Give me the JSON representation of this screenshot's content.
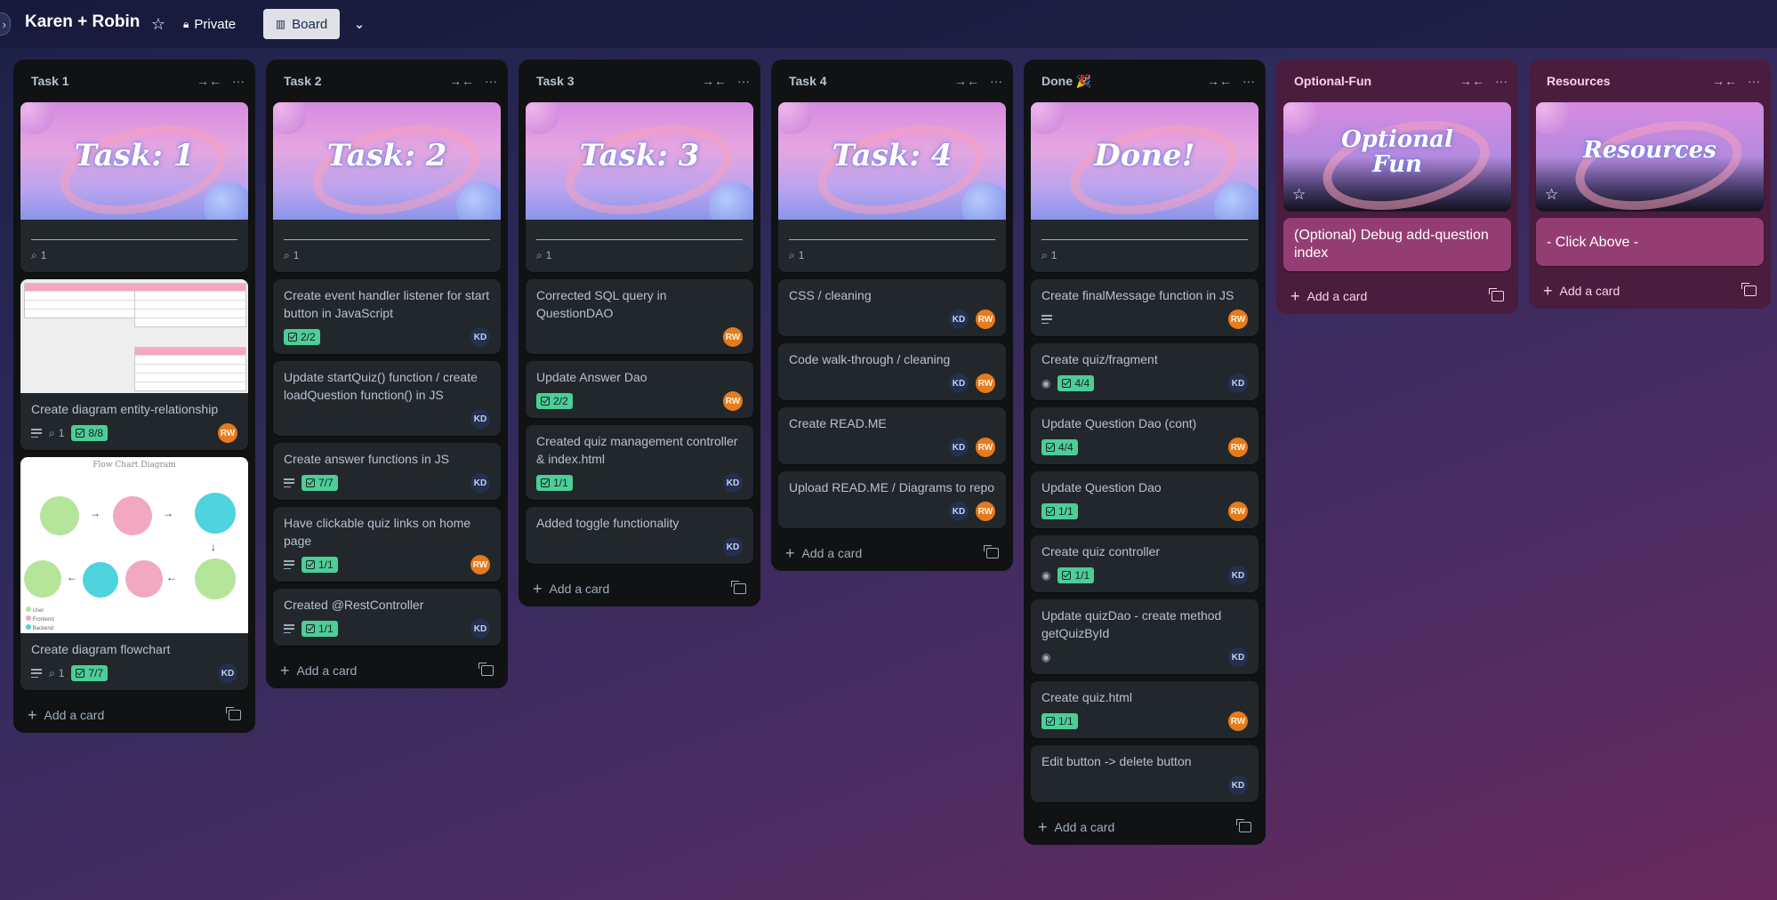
{
  "header": {
    "board_title": "Karen + Robin",
    "visibility": "Private",
    "view": "Board"
  },
  "colors": {
    "checklist_green": "#4bce97",
    "rw_avatar": "#e57a1f",
    "kd_avatar": "#23304f",
    "pink_list": "#4a1d3e"
  },
  "icons": [
    "star-icon",
    "lock-icon",
    "board-icon",
    "chevron-down-icon",
    "collapse-icon",
    "more-icon",
    "description-icon",
    "attachment-icon",
    "checklist-icon",
    "watch-icon",
    "plus-icon",
    "template-icon"
  ],
  "add_card_label": "Add a card",
  "lists": [
    {
      "title": "Task 1",
      "cover_text": "Task: 1",
      "cover_attachments": "1",
      "cards": [
        {
          "title": "Create diagram entity-relationship",
          "attachments": "1",
          "checklist": "8/8",
          "member": "RW"
        },
        {
          "title": "Create diagram flowchart",
          "attachments": "1",
          "checklist": "7/7",
          "member": "KD"
        }
      ]
    },
    {
      "title": "Task 2",
      "cover_text": "Task: 2",
      "cover_attachments": "1",
      "cards": [
        {
          "title": "Create event handler listener for start button in JavaScript",
          "checklist": "2/2",
          "member": "KD"
        },
        {
          "title": "Update startQuiz() function / create loadQuestion function() in JS",
          "member": "KD"
        },
        {
          "title": "Create answer functions in JS",
          "checklist": "7/7",
          "member": "KD"
        },
        {
          "title": "Have clickable quiz links on home page",
          "checklist": "1/1",
          "member": "RW"
        },
        {
          "title": "Created @RestController",
          "checklist": "1/1",
          "member": "KD"
        }
      ]
    },
    {
      "title": "Task 3",
      "cover_text": "Task: 3",
      "cover_attachments": "1",
      "cards": [
        {
          "title": "Corrected SQL query in QuestionDAO",
          "member": "RW"
        },
        {
          "title": "Update Answer Dao",
          "checklist": "2/2",
          "member": "RW"
        },
        {
          "title": "Created quiz management controller & index.html",
          "checklist": "1/1",
          "member": "KD"
        },
        {
          "title": "Added toggle functionality",
          "member": "KD"
        }
      ]
    },
    {
      "title": "Task 4",
      "cover_text": "Task: 4",
      "cover_attachments": "1",
      "cards": [
        {
          "title": "CSS / cleaning",
          "members": [
            "KD",
            "RW"
          ]
        },
        {
          "title": "Code walk-through / cleaning",
          "members": [
            "KD",
            "RW"
          ]
        },
        {
          "title": "Create READ.ME",
          "members": [
            "KD",
            "RW"
          ]
        },
        {
          "title": "Upload READ.ME / Diagrams to repo",
          "members": [
            "KD",
            "RW"
          ]
        }
      ]
    },
    {
      "title": "Done 🎉",
      "cover_text": "Done!",
      "cover_attachments": "1",
      "cards": [
        {
          "title": "Create finalMessage function in JS",
          "member": "RW"
        },
        {
          "title": "Create quiz/fragment",
          "checklist": "4/4",
          "member": "KD"
        },
        {
          "title": "Update Question Dao (cont)",
          "checklist": "4/4",
          "member": "RW"
        },
        {
          "title": "Update Question Dao",
          "checklist": "1/1",
          "member": "RW"
        },
        {
          "title": "Create quiz controller",
          "checklist": "1/1",
          "member": "KD"
        },
        {
          "title": "Update quizDao - create method getQuizById",
          "member": "KD"
        },
        {
          "title": "Create quiz.html",
          "checklist": "1/1",
          "member": "RW"
        },
        {
          "title": "Edit button -> delete button",
          "member": "KD"
        }
      ]
    },
    {
      "title": "Optional-Fun",
      "cover_text": "Optional Fun",
      "cards": [
        {
          "title": "(Optional) Debug add-question index"
        }
      ]
    },
    {
      "title": "Resources",
      "cover_text": "Resources",
      "cards": [
        {
          "title": "- Click Above -"
        }
      ]
    }
  ],
  "er_diagram": {
    "tables": [
      "quiz",
      "question",
      "answer"
    ],
    "rows": [
      "quiz_id INT NOT NULL AUTO_INCREMENT",
      "quiz_title VARCHAR(255)",
      "is_live BOOLEAN DEFAULT 0",
      "question_id INT NOT NULL AUTO_INCREMENT",
      "answer_id INT NOT NULL AUTO_INCREMENT"
    ]
  },
  "flowchart": {
    "title": "Flow Chart Diagram",
    "legend": [
      "User",
      "Frontend",
      "Backend"
    ]
  }
}
